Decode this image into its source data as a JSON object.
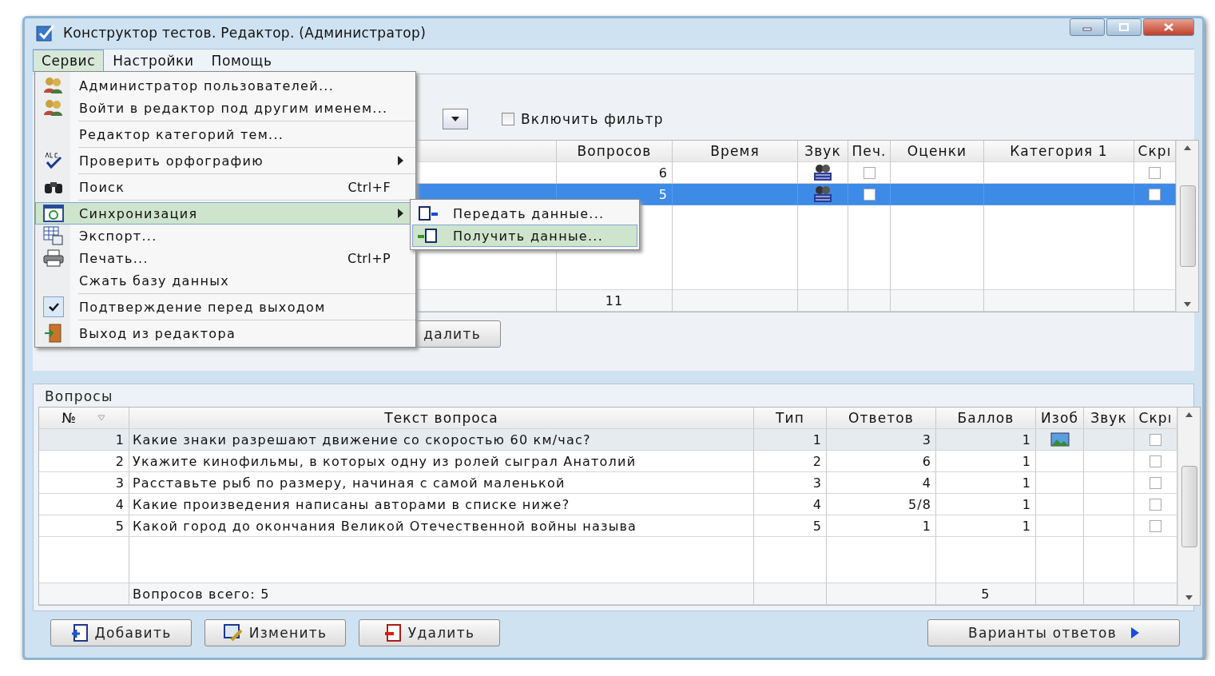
{
  "window": {
    "title": "Конструктор тестов. Редактор. (Администратор)"
  },
  "menu_bar": [
    {
      "label": "Сервис",
      "selected": true
    },
    {
      "label": "Настройки",
      "selected": false
    },
    {
      "label": "Помощь",
      "selected": false
    }
  ],
  "service_menu": {
    "items": [
      {
        "kind": "item",
        "label": "Администратор пользователей...",
        "selected": false
      },
      {
        "kind": "item",
        "label": "Войти в редактор под другим именем...",
        "selected": false
      },
      {
        "kind": "separator"
      },
      {
        "kind": "item",
        "label": "Редактор категорий тем...",
        "selected": false
      },
      {
        "kind": "separator"
      },
      {
        "kind": "item",
        "label": "Проверить орфографию",
        "submenu": true,
        "selected": false
      },
      {
        "kind": "separator"
      },
      {
        "kind": "item",
        "label": "Поиск",
        "shortcut": "Ctrl+F",
        "selected": false
      },
      {
        "kind": "separator"
      },
      {
        "kind": "item",
        "label": "Синхронизация",
        "submenu": true,
        "selected": true
      },
      {
        "kind": "item",
        "label": "Экспорт...",
        "selected": false
      },
      {
        "kind": "item",
        "label": "Печать...",
        "shortcut": "Ctrl+P",
        "selected": false
      },
      {
        "kind": "item",
        "label": "Сжать базу данных",
        "selected": false
      },
      {
        "kind": "separator"
      },
      {
        "kind": "item",
        "label": "Подтверждение перед выходом",
        "checked": true,
        "selected": false
      },
      {
        "kind": "separator"
      },
      {
        "kind": "item",
        "label": "Выход из редактора",
        "selected": false
      }
    ]
  },
  "sync_submenu": {
    "items": [
      {
        "label": "Передать данные...",
        "selected": false
      },
      {
        "label": "Получить данные...",
        "selected": true
      }
    ]
  },
  "filter": {
    "label": "Включить фильтр",
    "checked": false
  },
  "tests_table": {
    "columns": [
      "Вопросов",
      "Время",
      "Звук",
      "Печ.",
      "Оценки",
      "Категория 1",
      "Скрı"
    ],
    "rows": [
      {
        "questions": "6",
        "sound": true,
        "print": false,
        "hidden": false,
        "selected": false
      },
      {
        "questions": "5",
        "sound": true,
        "print": false,
        "hidden": false,
        "selected": true
      }
    ],
    "footer": {
      "questions": "11"
    }
  },
  "tests_buttons": [
    {
      "label": "далить"
    }
  ],
  "questions": {
    "title": "Вопросы",
    "columns": [
      "№",
      "Текст вопроса",
      "Тип",
      "Ответов",
      "Баллов",
      "Изоб",
      "Звук",
      "Скрı"
    ],
    "rows": [
      {
        "number": "1",
        "text": "Какие знаки разрешают движение со скоростью 60 км/час?",
        "type": "1",
        "answers": "3",
        "points": "1",
        "image": true,
        "hidden": false,
        "selected": true
      },
      {
        "number": "2",
        "text": "Укажите кинофильмы, в которых одну из ролей сыграл Анатолий",
        "type": "2",
        "answers": "6",
        "points": "1",
        "image": false,
        "hidden": false,
        "selected": false
      },
      {
        "number": "3",
        "text": "Расставьте рыб по размеру, начиная с самой маленькой",
        "type": "3",
        "answers": "4",
        "points": "1",
        "image": false,
        "hidden": false,
        "selected": false
      },
      {
        "number": "4",
        "text": "Какие произведения написаны авторами в списке ниже?",
        "type": "4",
        "answers": "5/8",
        "points": "1",
        "image": false,
        "hidden": false,
        "selected": false
      },
      {
        "number": "5",
        "text": "Какой город до окончания Великой Отечественной войны называ",
        "type": "5",
        "answers": "1",
        "points": "1",
        "image": false,
        "hidden": false,
        "selected": false
      }
    ],
    "footer": {
      "label": "Вопросов всего: 5",
      "points": "5"
    }
  },
  "buttons": [
    {
      "kind": "add",
      "label": "Добавить"
    },
    {
      "kind": "edit",
      "label": "Изменить"
    },
    {
      "kind": "delete",
      "label": "Удалить"
    }
  ],
  "answers_button": {
    "label": "Варианты ответов"
  }
}
